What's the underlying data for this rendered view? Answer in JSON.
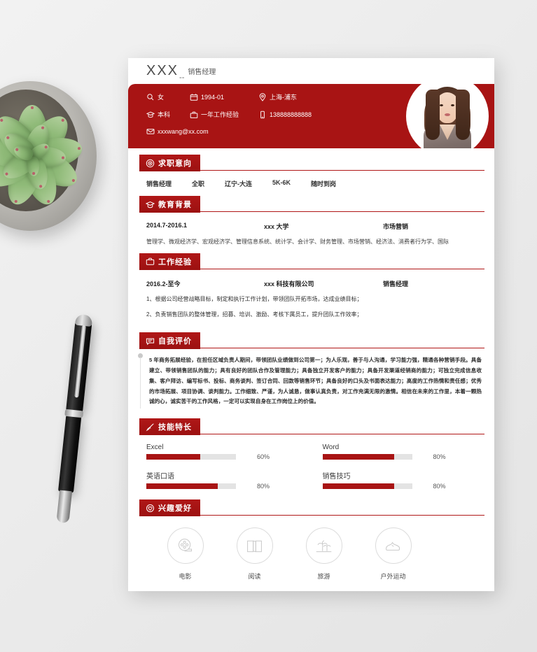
{
  "header": {
    "name": "XXX",
    "separator": "--",
    "job_title": "销售经理"
  },
  "contact": {
    "line1": [
      {
        "icon": "gender-icon",
        "text": "女"
      },
      {
        "icon": "calendar-icon",
        "text": "1994-01"
      },
      {
        "icon": "location-pin-icon",
        "text": "上海-浦东"
      }
    ],
    "line2": [
      {
        "icon": "graduation-cap-icon",
        "text": "本科"
      },
      {
        "icon": "briefcase-icon",
        "text": "一年工作经验"
      },
      {
        "icon": "mobile-phone-icon",
        "text": "138888888888"
      }
    ],
    "line3": [
      {
        "icon": "envelope-icon",
        "text": "xxxwang@xx.com"
      }
    ],
    "photo_alt": "profile-photo"
  },
  "sections": {
    "intention": {
      "title": "求职意向",
      "icon": "target-icon",
      "items": [
        "销售经理",
        "全职",
        "辽宁-大连",
        "5K-6K",
        "随时到岗"
      ]
    },
    "education": {
      "title": "教育背景",
      "icon": "graduation-cap-icon",
      "period": "2014.7-2016.1",
      "school": "xxx 大学",
      "major": "市场营销",
      "courses": "管理学、微观经济学、宏观经济学、管理信息系统、统计学、会计学、财务管理、市场营销、经济法、消费者行为学、国际"
    },
    "work": {
      "title": "工作经验",
      "icon": "briefcase-icon",
      "period": "2016.2-至今",
      "company": "xxx 科技有限公司",
      "role": "销售经理",
      "bullets": [
        "1、根据公司经营战略目标，制定和执行工作计划，带领团队开拓市场，达成业绩目标；",
        "2、负责销售团队的整体管理，招募、培训、激励、考核下属员工，提升团队工作效率；"
      ]
    },
    "evaluation": {
      "title": "自我评价",
      "icon": "speech-bubble-icon",
      "text": "5 年商务拓展经验，在担任区域负责人期间，带领团队业绩做到公司第一；为人乐观，善于与人沟通，学习能力强，精通各种营销手段。具备建立、带领销售团队的能力；具有良好的团队合作及管理能力；具备独立开发客户的能力；具备开发渠道经销商的能力；可独立完成信息收集、客户拜访、编写标书、投标、商务谈判、签订合同、回款等销售环节；具备良好的口头及书面表达能力；高度的工作热情和责任感；优秀的市场拓展、项目协调、谈判能力。工作细致、严谨，为人诚恳，做事认真负责，对工作充满无限的激情。相信在未来的工作里，本着一颗热诚的心，诚实苦干的工作风格，一定可以实现自身在工作岗位上的价值。"
    },
    "skills": {
      "title": "技能特长",
      "icon": "pen-nib-icon",
      "items": [
        {
          "name": "Excel",
          "percent": 60,
          "percent_label": "60%"
        },
        {
          "name": "Word",
          "percent": 80,
          "percent_label": "80%"
        },
        {
          "name": "英语口语",
          "percent": 80,
          "percent_label": "80%"
        },
        {
          "name": "销售技巧",
          "percent": 80,
          "percent_label": "80%"
        }
      ]
    },
    "hobbies": {
      "title": "兴趣爱好",
      "icon": "heart-circle-icon",
      "items": [
        {
          "label": "电影",
          "icon": "film-reel-icon"
        },
        {
          "label": "阅读",
          "icon": "open-book-icon"
        },
        {
          "label": "旅游",
          "icon": "palm-island-icon"
        },
        {
          "label": "户外运动",
          "icon": "sneaker-shoe-icon"
        }
      ]
    }
  },
  "theme": {
    "primary_red": "#a81414",
    "tag_red": "#b01717",
    "track_gray": "#e3e3e3",
    "page_white": "#ffffff",
    "backdrop_gray": "#eeeeee"
  },
  "decor": {
    "plant": "succulent-plant",
    "pen": "fountain-pen"
  }
}
